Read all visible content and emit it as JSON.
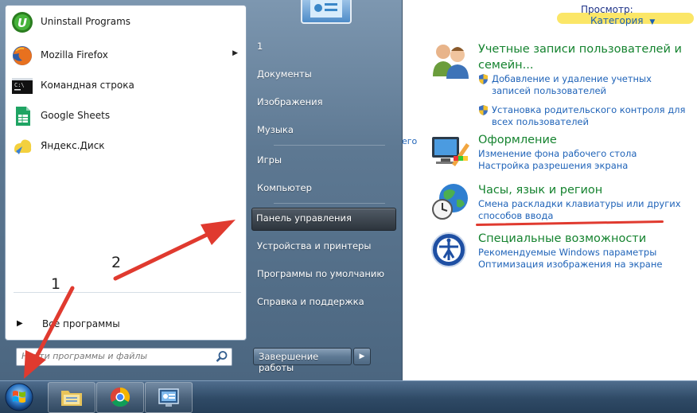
{
  "control_panel": {
    "view_label": "Просмотр:",
    "view_value": "Категория",
    "cut_text": "его",
    "categories": [
      {
        "title": "Учетные записи пользователей и семейн...",
        "links": [
          "Добавление и удаление учетных записей пользователей",
          "Установка родительского контроля для всех пользователей"
        ]
      },
      {
        "title": "Оформление",
        "links": [
          "Изменение фона рабочего стола",
          "Настройка разрешения экрана"
        ]
      },
      {
        "title": "Часы, язык и регион",
        "links": [
          "Смена раскладки клавиатуры или других способов ввода"
        ]
      },
      {
        "title": "Специальные возможности",
        "links": [
          "Рекомендуемые Windows параметры",
          "Оптимизация изображения на экране"
        ]
      }
    ]
  },
  "start_menu": {
    "programs": [
      {
        "label": "Uninstall Programs",
        "icon": "uninstall-icon"
      },
      {
        "label": "Mozilla Firefox",
        "icon": "firefox-icon"
      },
      {
        "label": "Командная строка",
        "icon": "cmd-icon"
      },
      {
        "label": "Google Sheets",
        "icon": "sheets-icon"
      },
      {
        "label": "Яндекс.Диск",
        "icon": "yandex-disk-icon"
      }
    ],
    "all_programs": "Все программы",
    "search_placeholder": "Найти программы и файлы",
    "right_items": [
      "1",
      "Документы",
      "Изображения",
      "Музыка",
      "Игры",
      "Компьютер",
      "Панель управления",
      "Устройства и принтеры",
      "Программы по умолчанию",
      "Справка и поддержка"
    ],
    "shutdown": "Завершение работы"
  },
  "annotations": {
    "step1": "1",
    "step2": "2"
  },
  "colors": {
    "link": "#1f63b8",
    "category_title": "#15832f",
    "arrow": "#e03a2f",
    "highlight": "#fbe667"
  }
}
